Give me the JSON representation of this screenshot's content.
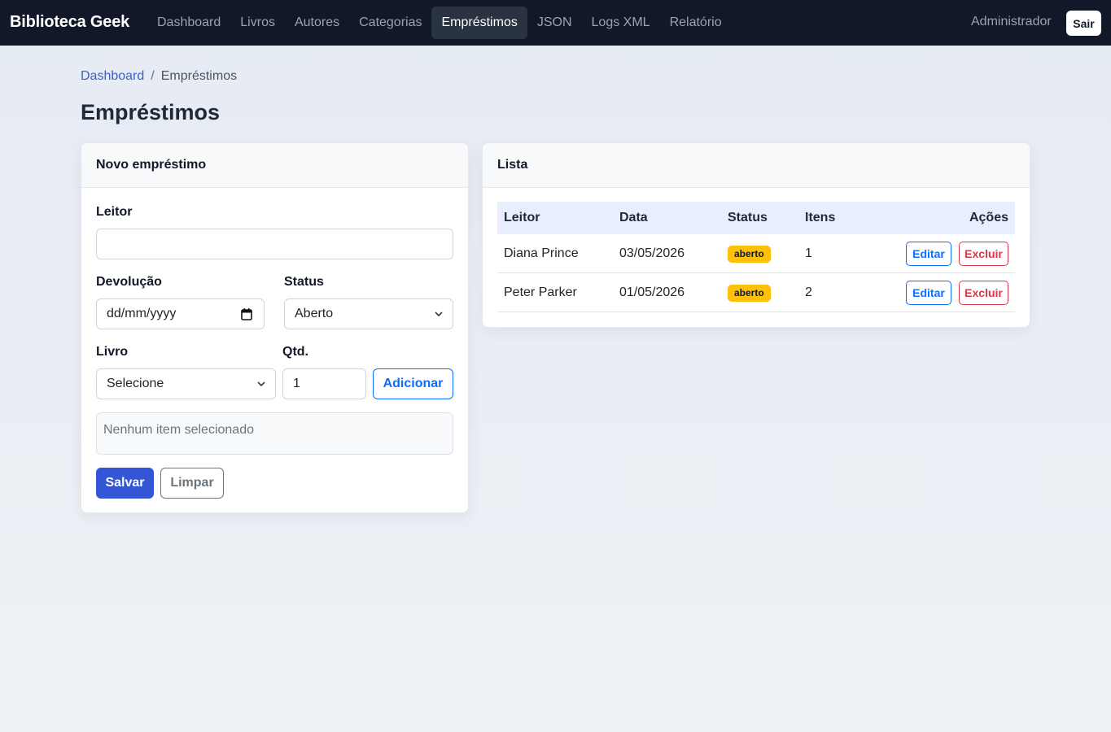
{
  "navbar": {
    "brand": "Biblioteca Geek",
    "links": [
      "Dashboard",
      "Livros",
      "Autores",
      "Categorias",
      "Empréstimos",
      "JSON",
      "Logs XML",
      "Relatório"
    ],
    "active_link": "Empréstimos",
    "user": "Administrador",
    "logout_label": "Sair"
  },
  "breadcrumb": {
    "home": "Dashboard",
    "separator": "/",
    "current": "Empréstimos"
  },
  "page_title": "Empréstimos",
  "form": {
    "header": "Novo empréstimo",
    "reader_label": "Leitor",
    "reader_value": "",
    "return_label": "Devolução",
    "return_placeholder": "dd/mm/yyyy",
    "status_label": "Status",
    "status_value": "Aberto",
    "book_label": "Livro",
    "book_value": "Selecione",
    "qty_label": "Qtd.",
    "qty_value": "1",
    "add_label": "Adicionar",
    "items_empty": "Nenhum item selecionado",
    "save_label": "Salvar",
    "clear_label": "Limpar"
  },
  "list": {
    "header": "Lista",
    "columns": [
      "Leitor",
      "Data",
      "Status",
      "Itens",
      "Ações"
    ],
    "rows": [
      {
        "reader": "Diana Prince",
        "date": "03/05/2026",
        "status": "aberto",
        "items": "1",
        "edit": "Editar",
        "delete": "Excluir"
      },
      {
        "reader": "Peter Parker",
        "date": "01/05/2026",
        "status": "aberto",
        "items": "2",
        "edit": "Editar",
        "delete": "Excluir"
      }
    ]
  },
  "colors": {
    "navbar_bg": "#111827",
    "primary": "#3355d6",
    "link": "#0d6efd",
    "danger": "#dc3545",
    "status_open": "#ffc107"
  }
}
